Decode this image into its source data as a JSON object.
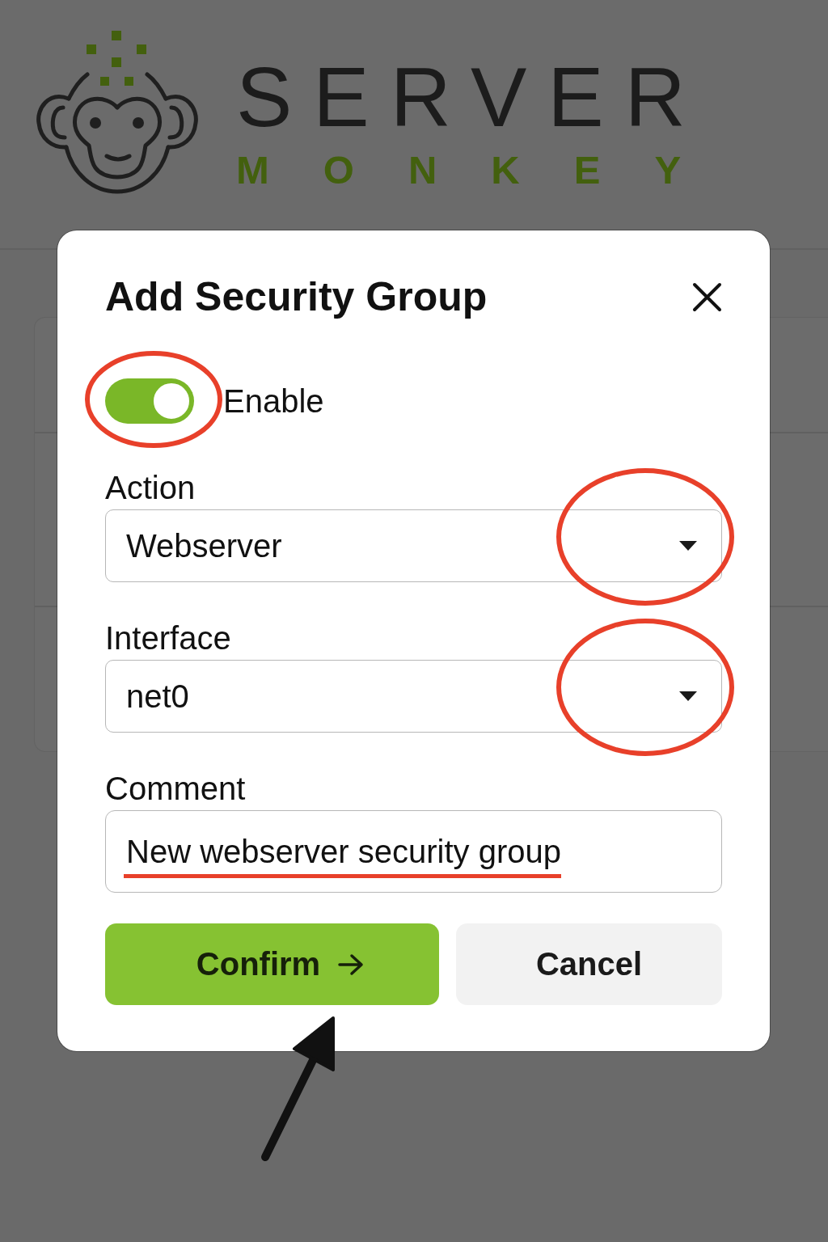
{
  "logo": {
    "wordmark": "SERVER",
    "tagline": "MONKEY"
  },
  "dialog": {
    "title": "Add Security Group",
    "enable": {
      "label": "Enable",
      "on": true,
      "circled": true
    },
    "fields": [
      {
        "kind": "select",
        "label": "Action",
        "value": "Webserver",
        "circled": true,
        "underlined": false
      },
      {
        "kind": "select",
        "label": "Interface",
        "value": "net0",
        "circled": true,
        "underlined": false
      },
      {
        "kind": "text",
        "label": "Comment",
        "value": "New webserver security group",
        "circled": false,
        "underlined": true
      }
    ],
    "buttons": [
      {
        "kind": "primary",
        "label": "Confirm",
        "pointed_at": true
      },
      {
        "kind": "secondary",
        "label": "Cancel",
        "pointed_at": false
      }
    ]
  }
}
